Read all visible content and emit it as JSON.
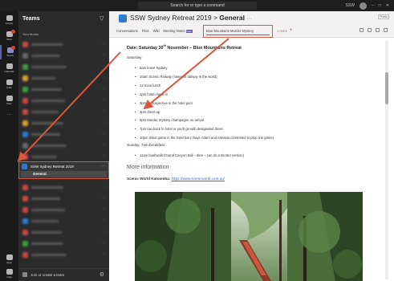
{
  "titlebar": {
    "search_placeholder": "Search for or type a command",
    "user_label": "SSW"
  },
  "rail": {
    "items": [
      {
        "label": "Activity",
        "icon": "bell-icon"
      },
      {
        "label": "Chat",
        "icon": "chat-icon"
      },
      {
        "label": "Teams",
        "icon": "teams-icon"
      },
      {
        "label": "Calendar",
        "icon": "calendar-icon"
      },
      {
        "label": "Calls",
        "icon": "phone-icon"
      },
      {
        "label": "Files",
        "icon": "file-icon"
      },
      {
        "label": "Apps",
        "icon": "apps-icon"
      },
      {
        "label": "Help",
        "icon": "help-icon"
      }
    ]
  },
  "panel": {
    "title": "Teams",
    "your_teams": "Your teams",
    "selected_team": "SSW Sydney Retreat 2019",
    "selected_channel": "General",
    "join_label": "Join or create a team"
  },
  "header": {
    "team": "SSW Sydney Retreat 2019",
    "channel": "General",
    "public_label": "Public",
    "tabs": [
      "Conversations",
      "Files",
      "Wiki",
      "Meeting Notes"
    ],
    "new_badge": "New",
    "active_tab": "Blue Mountains Murder Mystery",
    "more_label": "1 more"
  },
  "doc": {
    "heading_prefix": "Date: Saturday 30",
    "heading_sup": "th",
    "heading_suffix": " November – Blue Mountains Retreat",
    "saturday_label": "Saturday",
    "saturday_items": [
      "8am leave Sydney",
      "10am Scenic Railway (steepest railway in the world)",
      "12 noon lunch",
      "2pm hotel check-in",
      "3pm Retrospective in the hotel pool",
      "4pm dress up",
      "6pm Murder mystery champagne on arrival",
      "7pm taxi back to hotel or you'll go with designated driver",
      "10pm Initial game in the hotel bar (I have Adam and Artessia committed to play one game)"
    ],
    "sunday_label": "Sunday, 7am breakfast",
    "sunday_items": [
      "11am bushwalk (Grand Canyon trail – 6km – can do a shorter version)"
    ],
    "more_info": "More information",
    "scenic_label": "Scenic World Katoomba:",
    "scenic_link": "https://www.scenicworld.com.au/"
  }
}
